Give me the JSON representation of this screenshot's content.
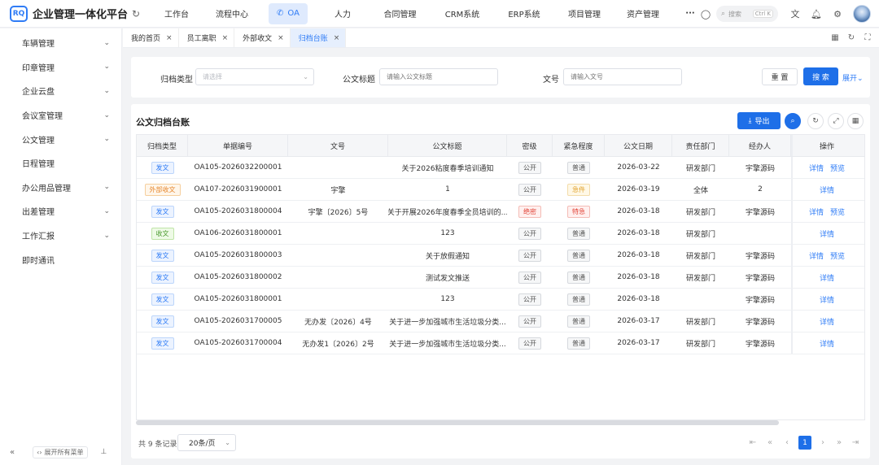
{
  "app": {
    "logo_badge": "RQ",
    "title": "企业管理一体化平台"
  },
  "nav": [
    {
      "label": "工作台"
    },
    {
      "label": "流程中心"
    },
    {
      "label": "OA",
      "active": true
    },
    {
      "label": "人力"
    },
    {
      "label": "合同管理"
    },
    {
      "label": "CRM系统"
    },
    {
      "label": "ERP系统"
    },
    {
      "label": "项目管理"
    },
    {
      "label": "资产管理"
    },
    {
      "label": "···"
    }
  ],
  "topright": {
    "search_placeholder": "搜索",
    "shortcut": "Ctrl K"
  },
  "sidebar": {
    "items": [
      {
        "label": "车辆管理",
        "expandable": true
      },
      {
        "label": "印章管理",
        "expandable": true
      },
      {
        "label": "企业云盘",
        "expandable": true
      },
      {
        "label": "会议室管理",
        "expandable": true
      },
      {
        "label": "公文管理",
        "expandable": true
      },
      {
        "label": "日程管理",
        "expandable": false
      },
      {
        "label": "办公用品管理",
        "expandable": true
      },
      {
        "label": "出差管理",
        "expandable": true
      },
      {
        "label": "工作汇报",
        "expandable": true
      },
      {
        "label": "即时通讯",
        "expandable": false
      }
    ],
    "expand_all_label": "展开所有菜单"
  },
  "tabs": [
    {
      "label": "我的首页",
      "active": false
    },
    {
      "label": "员工离职",
      "active": false
    },
    {
      "label": "外部收文",
      "active": false
    },
    {
      "label": "归档台账",
      "active": true
    }
  ],
  "filter": {
    "type_label": "归档类型",
    "type_placeholder": "请选择",
    "title_label": "公文标题",
    "title_placeholder": "请输入公文标题",
    "docno_label": "文号",
    "docno_placeholder": "请输入文号",
    "reset": "重 置",
    "search": "搜 索",
    "expand": "展开"
  },
  "panel": {
    "title": "公文归档台账",
    "export": "导出"
  },
  "table": {
    "headers": [
      "归档类型",
      "单据编号",
      "文号",
      "公文标题",
      "密级",
      "紧急程度",
      "公文日期",
      "责任部门",
      "经办人",
      "操作"
    ],
    "rows": [
      {
        "type": "发文",
        "type_color": "blue",
        "no": "OA105-2026032200001",
        "docno": "",
        "title": "关于2026粘度春季培训通知",
        "secret": "公开",
        "secret_color": "gray",
        "urgency": "普通",
        "urgency_color": "gray",
        "date": "2026-03-22",
        "dept": "研发部门",
        "handler": "宇擎源码",
        "actions": [
          "详情",
          "预览"
        ]
      },
      {
        "type": "外部收文",
        "type_color": "orange",
        "no": "OA107-2026031900001",
        "docno": "宇擎",
        "title": "1",
        "secret": "公开",
        "secret_color": "gray",
        "urgency": "急件",
        "urgency_color": "yellow",
        "date": "2026-03-19",
        "dept": "全体",
        "handler": "2",
        "actions": [
          "详情"
        ]
      },
      {
        "type": "发文",
        "type_color": "blue",
        "no": "OA105-2026031800004",
        "docno": "宇擎〔2026〕5号",
        "title": "关于开展2026年度春季全员培训的...",
        "secret": "绝密",
        "secret_color": "red",
        "urgency": "特急",
        "urgency_color": "red",
        "date": "2026-03-18",
        "dept": "研发部门",
        "handler": "宇擎源码",
        "actions": [
          "详情",
          "预览"
        ]
      },
      {
        "type": "收文",
        "type_color": "green",
        "no": "OA106-2026031800001",
        "docno": "",
        "title": "123",
        "secret": "公开",
        "secret_color": "gray",
        "urgency": "普通",
        "urgency_color": "gray",
        "date": "2026-03-18",
        "dept": "研发部门",
        "handler": "",
        "actions": [
          "详情"
        ]
      },
      {
        "type": "发文",
        "type_color": "blue",
        "no": "OA105-2026031800003",
        "docno": "",
        "title": "关于放假通知",
        "secret": "公开",
        "secret_color": "gray",
        "urgency": "普通",
        "urgency_color": "gray",
        "date": "2026-03-18",
        "dept": "研发部门",
        "handler": "宇擎源码",
        "actions": [
          "详情",
          "预览"
        ]
      },
      {
        "type": "发文",
        "type_color": "blue",
        "no": "OA105-2026031800002",
        "docno": "",
        "title": "测试发文推送",
        "secret": "公开",
        "secret_color": "gray",
        "urgency": "普通",
        "urgency_color": "gray",
        "date": "2026-03-18",
        "dept": "研发部门",
        "handler": "宇擎源码",
        "actions": [
          "详情"
        ]
      },
      {
        "type": "发文",
        "type_color": "blue",
        "no": "OA105-2026031800001",
        "docno": "",
        "title": "123",
        "secret": "公开",
        "secret_color": "gray",
        "urgency": "普通",
        "urgency_color": "gray",
        "date": "2026-03-18",
        "dept": "",
        "handler": "宇擎源码",
        "actions": [
          "详情"
        ]
      },
      {
        "type": "发文",
        "type_color": "blue",
        "no": "OA105-2026031700005",
        "docno": "无办发〔2026〕4号",
        "title": "关于进一步加强城市生活垃圾分类...",
        "secret": "公开",
        "secret_color": "gray",
        "urgency": "普通",
        "urgency_color": "gray",
        "date": "2026-03-17",
        "dept": "研发部门",
        "handler": "宇擎源码",
        "actions": [
          "详情"
        ]
      },
      {
        "type": "发文",
        "type_color": "blue",
        "no": "OA105-2026031700004",
        "docno": "无办发1〔2026〕2号",
        "title": "关于进一步加强城市生活垃圾分类...",
        "secret": "公开",
        "secret_color": "gray",
        "urgency": "普通",
        "urgency_color": "gray",
        "date": "2026-03-17",
        "dept": "研发部门",
        "handler": "宇擎源码",
        "actions": [
          "详情"
        ]
      }
    ]
  },
  "pagination": {
    "total": "共 9 条记录",
    "page_size": "20条/页",
    "current_page": "1"
  }
}
